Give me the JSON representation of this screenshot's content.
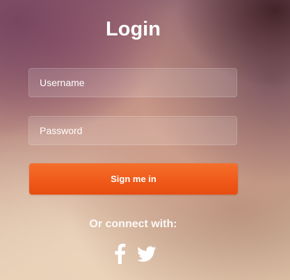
{
  "login": {
    "title": "Login",
    "username_placeholder": "Username",
    "password_placeholder": "Password",
    "sign_in_label": "Sign me in",
    "connect_text": "Or connect with:"
  },
  "social": {
    "icons": [
      "facebook-icon",
      "twitter-icon"
    ]
  },
  "colors": {
    "button": "#f05a1a",
    "text": "#ffffff"
  }
}
